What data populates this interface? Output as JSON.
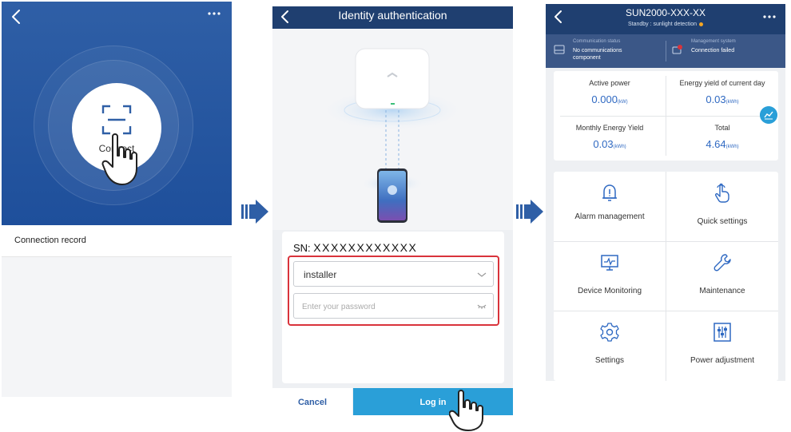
{
  "screen1": {
    "connect_label": "Connect",
    "connection_record": "Connection record"
  },
  "screen2": {
    "title": "Identity authentication",
    "sn_label": "SN:",
    "sn_value": "XXXXXXXXXXXX",
    "user_value": "installer",
    "password_placeholder": "Enter your password",
    "cancel_label": "Cancel",
    "login_label": "Log in"
  },
  "screen3": {
    "device_name": "SUN2000-XXX-XX",
    "status_text": "Standby : sunlight detection",
    "comm_label": "Communication status",
    "comm_value": "No communications component",
    "mgmt_label": "Management system",
    "mgmt_value": "Connection failed",
    "energy": [
      {
        "title": "Active power",
        "value": "0.000",
        "unit": "(kW)"
      },
      {
        "title": "Energy yield of current day",
        "value": "0.03",
        "unit": "(kWh)"
      },
      {
        "title": "Monthly Energy Yield",
        "value": "0.03",
        "unit": "(kWh)"
      },
      {
        "title": "Total",
        "value": "4.64",
        "unit": "(kWh)"
      }
    ],
    "menu": [
      {
        "label": "Alarm management",
        "icon": "bell-icon"
      },
      {
        "label": "Quick settings",
        "icon": "tap-hand-icon"
      },
      {
        "label": "Device Monitoring",
        "icon": "monitor-icon"
      },
      {
        "label": "Maintenance",
        "icon": "wrench-icon"
      },
      {
        "label": "Settings",
        "icon": "gear-icon"
      },
      {
        "label": "Power adjustment",
        "icon": "sliders-icon"
      }
    ]
  },
  "colors": {
    "primary_dark": "#1f3f70",
    "hero_blue": "#2f5fa6",
    "accent": "#2a9fd8",
    "value_blue": "#2f69c2",
    "alert_red": "#d9333b",
    "status_dot": "#f5a623"
  }
}
